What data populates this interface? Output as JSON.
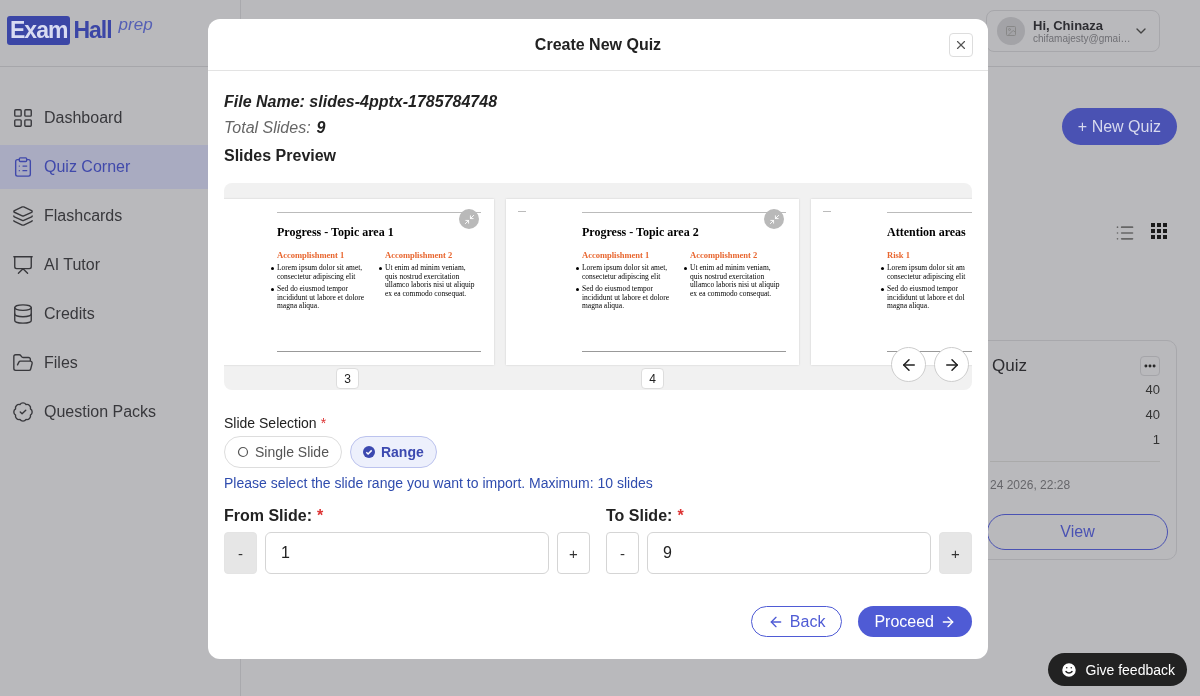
{
  "logo": {
    "box_word": "Exam",
    "word": "Hall",
    "suffix": "prep"
  },
  "sidebar": {
    "items": [
      {
        "label": "Dashboard",
        "selected": false
      },
      {
        "label": "Quiz Corner",
        "selected": true
      },
      {
        "label": "Flashcards",
        "selected": false
      },
      {
        "label": "AI Tutor",
        "selected": false
      },
      {
        "label": "Credits",
        "selected": false
      },
      {
        "label": "Files",
        "selected": false
      },
      {
        "label": "Question Packs",
        "selected": false
      }
    ]
  },
  "user": {
    "greeting": "Hi, Chinaza",
    "email": "chifamajesty@gmai…"
  },
  "new_quiz_button": "+ New Quiz",
  "view_toggle": [
    {
      "kind": "list",
      "selected": false
    },
    {
      "kind": "grid",
      "selected": true
    }
  ],
  "quiz_card": {
    "title": "Quiz",
    "values": [
      "40",
      "40",
      "1"
    ],
    "date": "24 2026, 22:28",
    "button": "View"
  },
  "feedback_button": "Give feedback",
  "dialog": {
    "title": "Create New Quiz",
    "file_name": "File Name: slides-4pptx-1785784748",
    "total_label": "Total Slides:",
    "total_value": "9",
    "preview_title": "Slides Preview",
    "slides": [
      {
        "number": "3",
        "collapse_button": true,
        "title": "Progress - Topic area 1",
        "columns": [
          {
            "heading": "Accomplishment 1",
            "bullets": [
              [
                "Lorem ipsum dolor sit amet,",
                "consectetur adipiscing elit"
              ],
              [
                "Sed do eiusmod tempor",
                "incididunt ut labore et dolore",
                "magna aliqua."
              ]
            ]
          },
          {
            "heading": "Accomplishment 2",
            "bullets": [
              [
                "Ut enim ad minim veniam,",
                "quis nostrud exercitation",
                "ullamco laboris nisi ut aliquip",
                "ex ea commodo consequat."
              ]
            ]
          }
        ]
      },
      {
        "number": "4",
        "collapse_button": true,
        "title": "Progress - Topic area 2",
        "columns": [
          {
            "heading": "Accomplishment 1",
            "bullets": [
              [
                "Lorem ipsum dolor sit amet,",
                "consectetur adipiscing elit"
              ],
              [
                "Sed do eiusmod tempor",
                "incididunt ut labore et dolore",
                "magna aliqua."
              ]
            ]
          },
          {
            "heading": "Accomplishment 2",
            "bullets": [
              [
                "Ut enim ad minim veniam,",
                "quis nostrud exercitation",
                "ullamco laboris nisi ut aliquip",
                "ex ea commodo consequat."
              ]
            ]
          }
        ]
      },
      {
        "title": "Attention areas",
        "columns": [
          {
            "heading": "Risk 1",
            "bullets": [
              [
                "Lorem ipsum dolor sit am",
                "consectetur adipiscing elit"
              ],
              [
                "Sed do eiusmod tempor",
                "incididunt ut labore et dol",
                "magna aliqua."
              ]
            ]
          }
        ]
      }
    ],
    "selection": {
      "label": "Slide Selection",
      "required_mark": "*",
      "options": [
        {
          "label": "Single Slide",
          "selected": false
        },
        {
          "label": "Range",
          "selected": true
        }
      ]
    },
    "help": "Please select the slide range you want to import. Maximum: 10 slides",
    "steppers": [
      {
        "label": "From Slide:",
        "required_mark": "*",
        "minus": "-",
        "plus": "+",
        "value": "1",
        "minus_disabled": true,
        "plus_disabled": false
      },
      {
        "label": "To Slide:",
        "required_mark": "*",
        "minus": "-",
        "plus": "+",
        "value": "9",
        "minus_disabled": false,
        "plus_disabled": true
      }
    ],
    "back_button": "Back",
    "proceed_button": "Proceed"
  }
}
